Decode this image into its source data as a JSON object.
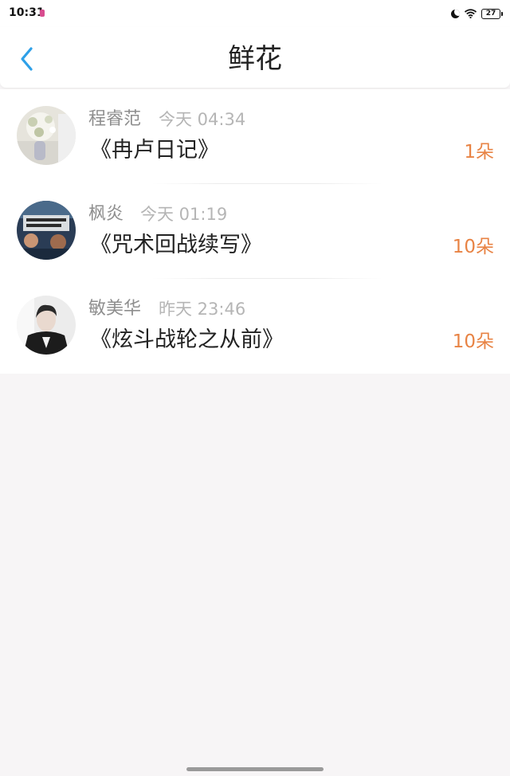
{
  "status_bar": {
    "time": "10:31",
    "battery": "27",
    "icons": [
      "app-notification-icon",
      "moon-icon",
      "wifi-icon",
      "battery-icon"
    ]
  },
  "header": {
    "title": "鲜花",
    "back_icon": "chevron-left-icon",
    "accent_color": "#2ea0e8"
  },
  "items": [
    {
      "user": "程睿范",
      "time": "今天 04:34",
      "book": "《冉卢日记》",
      "count": "1朵"
    },
    {
      "user": "枫炎",
      "time": "今天 01:19",
      "book": "《咒术回战续写》",
      "count": "10朵"
    },
    {
      "user": "敏美华",
      "time": "昨天 23:46",
      "book": "《炫斗战轮之从前》",
      "count": "10朵"
    }
  ],
  "colors": {
    "count": "#e88344",
    "name": "#8e8e8e",
    "time": "#b5b5b5",
    "background": "#f7f5f6"
  }
}
